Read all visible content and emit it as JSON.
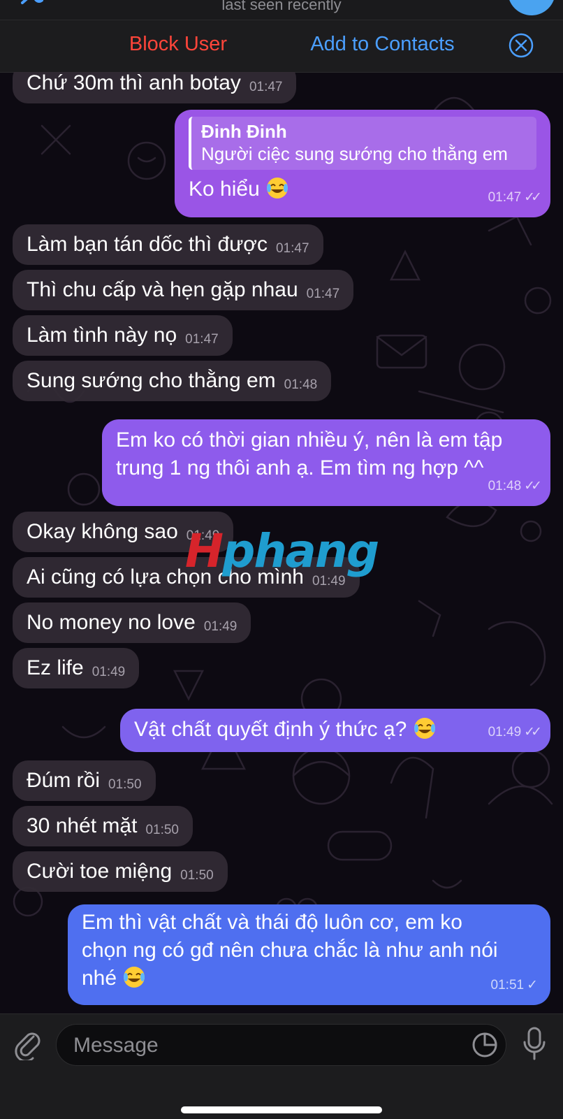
{
  "header": {
    "status": "last seen recently"
  },
  "action_bar": {
    "block_label": "Block User",
    "add_label": "Add to Contacts"
  },
  "colors": {
    "outgoing_purple": "#9a55e6",
    "outgoing_blue": "#4f6ff0",
    "incoming": "#322a34",
    "block_red": "#ff453a",
    "link_blue": "#4b9fff"
  },
  "messages": [
    {
      "dir": "in",
      "text": "Chứ 30m thì anh botay",
      "time": "01:47"
    },
    {
      "dir": "out",
      "reply_name": "Đinh Đinh",
      "reply_text": "Người ciệc sung sướng cho thằng em",
      "text": "Ko hiểu",
      "emoji": "tears-of-joy",
      "time": "01:47",
      "read": true
    },
    {
      "dir": "in",
      "text": "Làm bạn tán dốc thì được",
      "time": "01:47"
    },
    {
      "dir": "in",
      "text": "Thì chu cấp và hẹn gặp nhau",
      "time": "01:47"
    },
    {
      "dir": "in",
      "text": "Làm tình này nọ",
      "time": "01:47"
    },
    {
      "dir": "in",
      "text": "Sung sướng cho thằng em",
      "time": "01:48"
    },
    {
      "dir": "out",
      "lines": [
        "Em ko có thời gian nhiều ý, nên là em tập",
        "trung 1 ng thôi anh ạ. Em tìm ng hợp ^^"
      ],
      "time": "01:48",
      "read": true
    },
    {
      "dir": "in",
      "text": "Okay không sao",
      "time": "01:49"
    },
    {
      "dir": "in",
      "text": "Ai cũng có lựa chọn cho mình",
      "time": "01:49"
    },
    {
      "dir": "in",
      "text": "No money no love",
      "time": "01:49"
    },
    {
      "dir": "in",
      "text": "Ez life",
      "time": "01:49"
    },
    {
      "dir": "out",
      "text": "Vật chất quyết định ý thức ạ?",
      "emoji": "tears-of-joy",
      "time": "01:49",
      "read": true
    },
    {
      "dir": "in",
      "text": "Đúm rồi",
      "time": "01:50"
    },
    {
      "dir": "in",
      "text": "30 nhét mặt",
      "time": "01:50"
    },
    {
      "dir": "in",
      "text": "Cười toe miệng",
      "time": "01:50"
    },
    {
      "dir": "out",
      "lines": [
        "Em thì vật chất và thái độ luôn cơ, em ko",
        "chọn ng có gđ nên chưa chắc là như anh nói",
        "nhé"
      ],
      "emoji": "tears-of-joy",
      "time": "01:51",
      "read": false
    }
  ],
  "watermark": {
    "part1": "H",
    "part2": "phang"
  },
  "input": {
    "placeholder": "Message"
  }
}
